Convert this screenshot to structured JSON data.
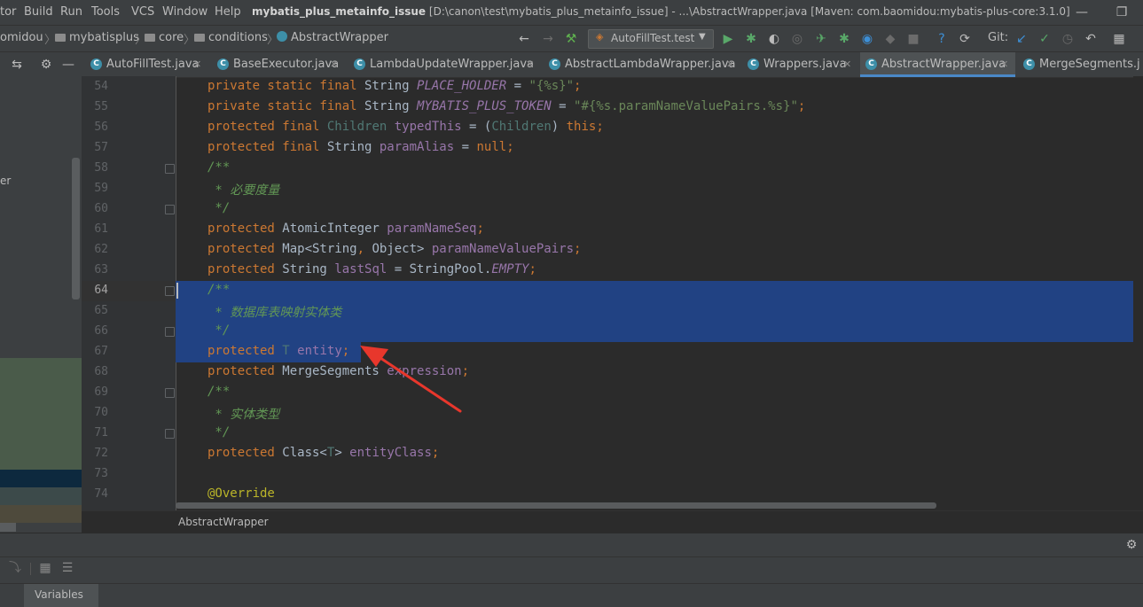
{
  "menu": {
    "items": [
      "tor",
      "Build",
      "Run",
      "Tools",
      "VCS",
      "Window",
      "Help"
    ],
    "title_bold": "mybatis_plus_metainfo_issue",
    "title_rest": " [D:\\canon\\test\\mybatis_plus_metainfo_issue] - ...\\AbstractWrapper.java [Maven: com.baomidou:mybatis-plus-core:3.1.0]"
  },
  "nav": {
    "crumbs": [
      "omidou",
      "mybatisplus",
      "core",
      "conditions",
      "AbstractWrapper"
    ],
    "run_config": "AutoFillTest.test",
    "git_label": "Git:"
  },
  "tabs": [
    "AutoFillTest.java",
    "BaseExecutor.java",
    "LambdaUpdateWrapper.java",
    "AbstractLambdaWrapper.java",
    "Wrappers.java",
    "AbstractWrapper.java",
    "MergeSegments.j"
  ],
  "left_panel": {
    "label": "er"
  },
  "line_numbers": [
    "54",
    "55",
    "56",
    "57",
    "58",
    "59",
    "60",
    "61",
    "62",
    "63",
    "64",
    "65",
    "66",
    "67",
    "68",
    "69",
    "70",
    "71",
    "72",
    "73",
    "74"
  ],
  "code": {
    "l54": [
      "private static final",
      " String ",
      "PLACE_HOLDER",
      " = ",
      "\"{%s}\"",
      ";"
    ],
    "l55": [
      "private static final",
      " String ",
      "MYBATIS_PLUS_TOKEN",
      " = ",
      "\"#{%s.paramNameValuePairs.%s}\"",
      ";"
    ],
    "l56": [
      "protected final",
      " ",
      "Children",
      " ",
      "typedThis",
      " = (",
      "Children",
      ") ",
      "this",
      ";"
    ],
    "l57": [
      "protected final",
      " String ",
      "paramAlias",
      " = ",
      "null",
      ";"
    ],
    "l58": "/**",
    "l59": " * 必要度量",
    "l60": " */",
    "l61": [
      "protected",
      " AtomicInteger ",
      "paramNameSeq",
      ";"
    ],
    "l62": [
      "protected",
      " Map<String",
      ",",
      " Object> ",
      "paramNameValuePairs",
      ";"
    ],
    "l63": [
      "protected",
      " String ",
      "lastSql",
      " = StringPool.",
      "EMPTY",
      ";"
    ],
    "l64": "/**",
    "l65": " * 数据库表映射实体类",
    "l66": " */",
    "l67": [
      "protected",
      " ",
      "T",
      " ",
      "entity",
      ";"
    ],
    "l68": [
      "protected",
      " MergeSegments ",
      "expression",
      ";"
    ],
    "l69": "/**",
    "l70": " * 实体类型",
    "l71": " */",
    "l72": [
      "protected",
      " Class<",
      "T",
      "> ",
      "entityClass",
      ";"
    ],
    "l74": "@Override"
  },
  "footer": {
    "breadcrumb": "AbstractWrapper"
  },
  "bottom": {
    "tab_label": "Variables"
  },
  "colors": {
    "selection": "#214283",
    "arrow": "#e8372c",
    "keyword": "#cc7832",
    "field": "#9876aa"
  }
}
